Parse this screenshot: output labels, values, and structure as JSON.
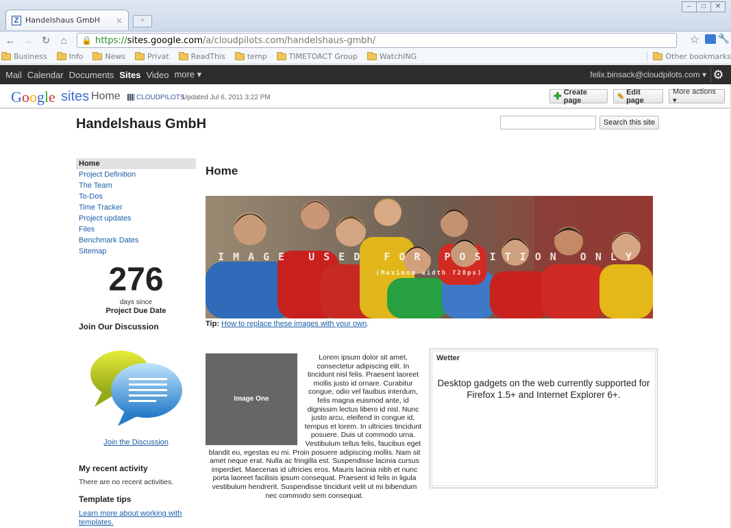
{
  "browser": {
    "tab_title": "Handelshaus GmbH",
    "tab_close": "×",
    "url_scheme": "https://",
    "url_host": "sites.google.com",
    "url_path": "/a/cloudpilots.com/handelshaus-gmbh/",
    "bookmarks": [
      "Business",
      "Info",
      "News",
      "Privat",
      "ReadThis",
      "temp",
      "TIMETOACT Group",
      "WatchING"
    ],
    "other_bookmarks": "Other bookmarks"
  },
  "gbar": {
    "links": [
      "Mail",
      "Calendar",
      "Documents",
      "Sites",
      "Video",
      "more ▾"
    ],
    "user": "felix.binsack@cloudpilots.com ▾"
  },
  "sites_header": {
    "logo_google": "Google",
    "logo_sites": "sites",
    "page_name": "Home",
    "domain": "CLOUDPILOTS",
    "updated": "Updated Jul 6, 2011 3:22 PM",
    "create_page": "Create page",
    "edit_page": "Edit page",
    "more_actions": "More actions ▾"
  },
  "site": {
    "title": "Handelshaus GmbH",
    "search_button": "Search this site",
    "search_value": ""
  },
  "sidebar": {
    "nav": [
      "Home",
      "Project Definition",
      "The Team",
      "To-Dos",
      "Time Tracker",
      "Project updates",
      "Files",
      "Benchmark Dates",
      "Sitemap"
    ],
    "countdown_number": "276",
    "countdown_caption": "days since",
    "countdown_event": "Project Due Date",
    "join_heading": "Join Our Discussion",
    "join_link": "Join the Discussion",
    "activity_heading": "My recent activity",
    "activity_text": "There are no recent activities.",
    "tips_heading": "Template tips",
    "tips_link": "Learn more about working with templates."
  },
  "main": {
    "heading": "Home",
    "banner_caption": "IMAGE USED FOR POSITION ONLY",
    "banner_sub": "(Maximum width 728px)",
    "tip_label": "Tip:",
    "tip_link": "How to replace these images with your own",
    "tip_end": ".",
    "image_label": "Image One",
    "article_text": "Lorem ipsum dolor sit amet, consectetur adipiscing elit. In tincidunt nisl felis. Praesent laoreet mollis justo id ornare. Curabitur congue, odio vel fauibus interdum, felis magna euismod ante, id dignissim lectus libero id nisl. Nunc justo arcu, eleifend in congue id, tempus et lorem. In ultricies tincidunt posuere. Duis ut commodo urna. Vestibulum tellus felis, faucibus eget blandit eu, egestas eu mi. Proin posuere adipiscing mollis. Nam sit amet neque erat. Nulla ac fringilla est. Suspendisse lacinia cursus imperdiet. Maecenas id ultricies eros. Mauris lacinia nibh et nunc porta laoreet facilisis ipsum consequat. Praesent id felis in ligula vestibulum hendrerit. Suspendisse tincidunt velit ut mi bibendum nec commodo sem consequat."
  },
  "gadget": {
    "title": "Wetter",
    "body": "Desktop gadgets on the web currently supported for Firefox 1.5+ and Internet Explorer 6+."
  }
}
